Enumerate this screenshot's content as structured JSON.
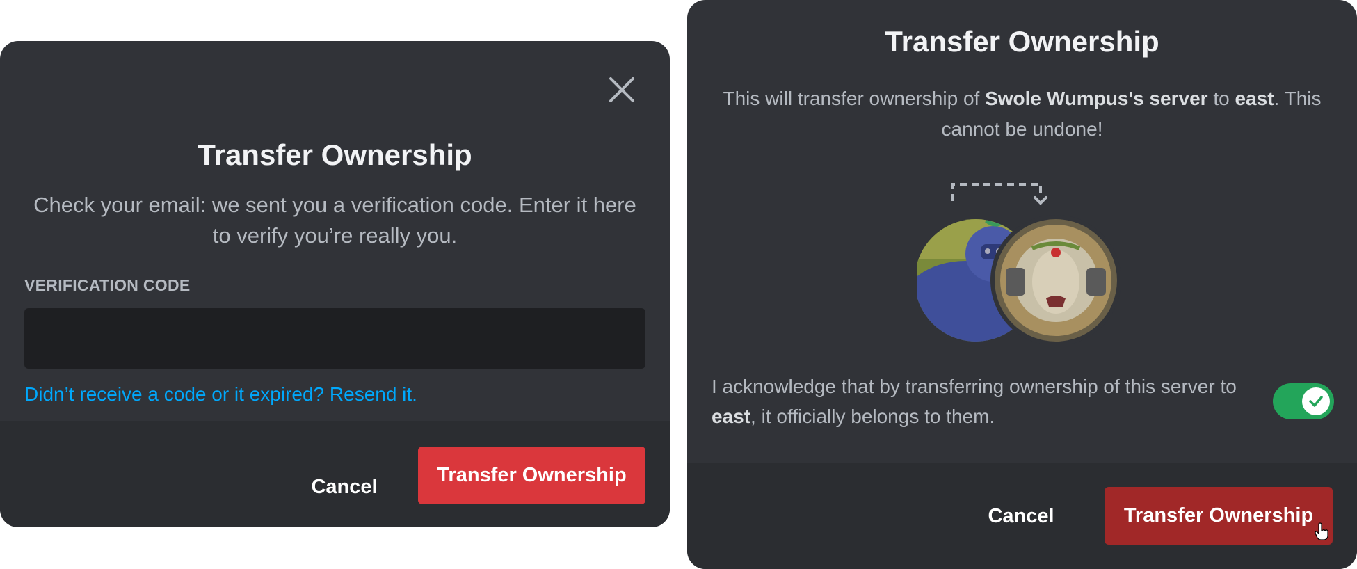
{
  "left_modal": {
    "title": "Transfer Ownership",
    "description": "Check your email: we sent you a verification code. Enter it here to verify you’re really you.",
    "field_label": "VERIFICATION CODE",
    "code_value": "",
    "code_placeholder": "",
    "resend_link": "Didn’t receive a code or it expired? Resend it.",
    "cancel_label": "Cancel",
    "confirm_label": "Transfer Ownership"
  },
  "right_modal": {
    "title": "Transfer Ownership",
    "desc_prefix": "This will transfer ownership of ",
    "server_name": "Swole Wumpus's server",
    "desc_to": " to ",
    "new_owner": "east",
    "desc_suffix": ". This cannot be undone!",
    "ack_prefix": "I acknowledge that by transferring ownership of this server to ",
    "ack_user": "east",
    "ack_suffix": ", it officially belongs to them.",
    "acknowledge_checked": true,
    "cancel_label": "Cancel",
    "confirm_label": "Transfer Ownership"
  },
  "colors": {
    "modal_bg": "#313338",
    "footer_bg": "#2b2d31",
    "danger": "#da373c",
    "danger_pressed": "#a12828",
    "link": "#00a8fc",
    "toggle_on": "#23a55a"
  },
  "icons": [
    "close-icon",
    "transfer-arrow-icon",
    "check-icon",
    "hand-cursor-icon"
  ]
}
